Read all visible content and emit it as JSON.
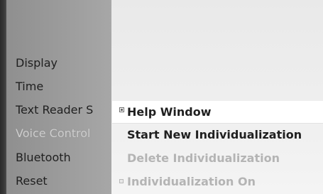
{
  "left_menu": {
    "items": [
      {
        "label": "Display"
      },
      {
        "label": "Time"
      },
      {
        "label": "Text Reader S"
      },
      {
        "label": "Voice Control"
      },
      {
        "label": "Bluetooth"
      },
      {
        "label": "Reset"
      }
    ],
    "selected_index": 3
  },
  "submenu": {
    "items": [
      {
        "label": "Help Window",
        "state": "selected"
      },
      {
        "label": "Start New Individualization",
        "state": "enabled"
      },
      {
        "label": "Delete Individualization",
        "state": "disabled"
      },
      {
        "label": "Individualization On",
        "state": "disabled"
      }
    ]
  },
  "colors": {
    "left_panel": "#9c9c9c",
    "right_panel": "#efefef",
    "highlight_text": "#cfcfcf",
    "disabled_text": "#b4b4b4",
    "selected_row_bg": "#ffffff"
  }
}
